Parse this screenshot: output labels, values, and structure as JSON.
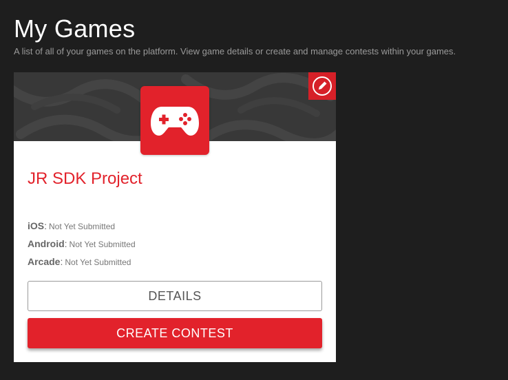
{
  "header": {
    "title": "My Games",
    "subtitle": "A list of all of your games on the platform. View game details or create and manage contests within your games."
  },
  "colors": {
    "accent": "#e2222b",
    "background": "#1e1e1e",
    "banner": "#3a3a3a"
  },
  "game_card": {
    "title": "JR SDK Project",
    "icon": "gamepad-icon",
    "edit_icon": "pencil-icon",
    "platforms": [
      {
        "name": "iOS",
        "status": "Not Yet Submitted"
      },
      {
        "name": "Android",
        "status": "Not Yet Submitted"
      },
      {
        "name": "Arcade",
        "status": "Not Yet Submitted"
      }
    ],
    "details_label": "DETAILS",
    "create_contest_label": "CREATE CONTEST"
  }
}
